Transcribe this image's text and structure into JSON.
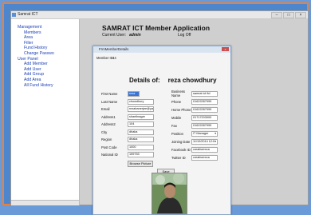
{
  "window": {
    "title": "Samrat ICT"
  },
  "tree": {
    "items": [
      {
        "label": "Management",
        "indent": 0
      },
      {
        "label": "Members",
        "indent": 1
      },
      {
        "label": "Area",
        "indent": 1
      },
      {
        "label": "Filter",
        "indent": 1
      },
      {
        "label": "Fund History",
        "indent": 1
      },
      {
        "label": "Change Passwo",
        "indent": 1
      },
      {
        "label": "User Panel",
        "indent": 0
      },
      {
        "label": "Add Member",
        "indent": 1
      },
      {
        "label": "Add User",
        "indent": 1
      },
      {
        "label": "Add Group",
        "indent": 1
      },
      {
        "label": "Add Area",
        "indent": 1
      },
      {
        "label": "All Fund History",
        "indent": 1
      }
    ]
  },
  "header": {
    "app_title": "SAMRAT ICT Member Application",
    "current_user_label": "Current User:",
    "current_user": "admin",
    "logoff": "Log Off"
  },
  "dialog": {
    "title": "FrmMemberDetails",
    "member_id_label": "Member ID:",
    "member_id": "44",
    "details_of": "Details of:",
    "member_name": "reza chowdhury",
    "left_fields": [
      {
        "label": "First Name",
        "value": "reza"
      },
      {
        "label": "Last Name",
        "value": "chowdhury"
      },
      {
        "label": "Email",
        "value": "rezabanerjee@yaho"
      },
      {
        "label": "Address1",
        "value": "shantinagar"
      },
      {
        "label": "Address2",
        "value": "104"
      },
      {
        "label": "City",
        "value": "dhaka"
      },
      {
        "label": "Region",
        "value": "dhaka"
      },
      {
        "label": "Post Code",
        "value": "1000"
      },
      {
        "label": "National ID",
        "value": "159753"
      }
    ],
    "right_fields": [
      {
        "label": "Business Name",
        "value": "samrat ict ltd"
      },
      {
        "label": "Phone",
        "value": "01622287999"
      },
      {
        "label": "Home Phone",
        "value": "01622287999"
      },
      {
        "label": "Mobile",
        "value": "01717203000"
      },
      {
        "label": "Fax",
        "value": "01622287999"
      },
      {
        "label": "Position",
        "value": "IT Manager"
      },
      {
        "label": "Joining Date",
        "value": "11/10/2014 12:0"
      },
      {
        "label": "Facebook ID",
        "value": "creativereza"
      },
      {
        "label": "Twitter ID",
        "value": "creativereza"
      }
    ],
    "browse_button": "Browse Picture",
    "save_button": "Save"
  }
}
